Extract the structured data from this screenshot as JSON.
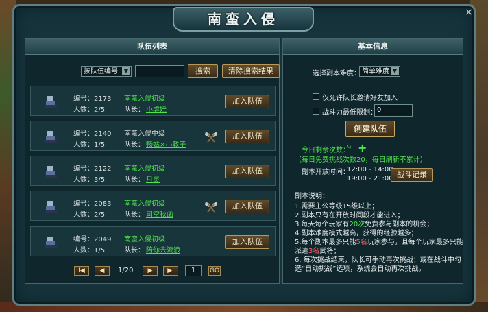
{
  "window": {
    "title": "南蛮入侵",
    "close": "×"
  },
  "team_list": {
    "header": "队伍列表",
    "filter_select": "按队伍编号",
    "search_value": "",
    "search_button": "搜索",
    "clear_button": "清除搜索结果",
    "teams": [
      {
        "id_label": "编号：2173",
        "count_label": "人数：2/5",
        "name": "南蛮入侵初级",
        "name_color": "green",
        "leader_prefix": "队长：",
        "leader": "小虐娃",
        "axe": false,
        "join": "加入队伍"
      },
      {
        "id_label": "编号：2140",
        "count_label": "人数：1/5",
        "name": "南蛮入侵中级",
        "name_color": "gray",
        "leader_prefix": "队长：",
        "leader": "畅姑×小敦子",
        "axe": true,
        "join": "加入队伍"
      },
      {
        "id_label": "编号：2122",
        "count_label": "人数：3/5",
        "name": "南蛮入侵初级",
        "name_color": "green",
        "leader_prefix": "队长：",
        "leader": "月灵",
        "axe": false,
        "join": "加入队伍"
      },
      {
        "id_label": "编号：2083",
        "count_label": "人数：2/5",
        "name": "南蛮入侵初级",
        "name_color": "green",
        "leader_prefix": "队长：",
        "leader": "司空秋函",
        "axe": true,
        "join": "加入队伍"
      },
      {
        "id_label": "编号：2049",
        "count_label": "人数：1/5",
        "name": "南蛮入侵初级",
        "name_color": "green",
        "leader_prefix": "队长：",
        "leader": "陪你去流浪",
        "axe": false,
        "join": "加入队伍"
      }
    ],
    "pager": {
      "first": "I◀",
      "prev": "◀",
      "page_text": "1/20",
      "next": "▶",
      "last": "▶I",
      "page_input": "1",
      "go": "GO"
    }
  },
  "basic_info": {
    "header": "基本信息",
    "difficulty_label": "选择副本难度：",
    "difficulty_value": "简单难度",
    "friends_only": "仅允许队长邀请好友加入",
    "power_limit_label": "战斗力最低限制：",
    "power_limit_value": "0",
    "create_button": "创建队伍",
    "remaining_label": "今日剩余次数：",
    "remaining_value": "9",
    "remaining_note": "（每日免费挑战次数20，每日刷新不累计）",
    "open_time_label": "副本开放时间：",
    "open_time_1": "12:00 - 14:00",
    "open_time_2": "19:00 - 21:00",
    "battle_log_button": "战斗记录",
    "desc_title": "副本说明：",
    "desc_1": "1.需要主公等级15级以上；",
    "desc_2": "2.副本只有在开放时间段才能进入；",
    "desc_3a": "3.每天每个玩家有",
    "desc_3b": "20次",
    "desc_3c": "免费参与副本的机会；",
    "desc_4": "4.副本难度模式越高，获得的经验越多；",
    "desc_5a": "5.每个副本最多只能",
    "desc_5b": "5名",
    "desc_5c": "玩家参与，且每个玩家最多只能派遣",
    "desc_5d": "3名",
    "desc_5e": "武将；",
    "desc_6": "6. 每次挑战结束，队长可手动再次挑战；或在战斗中勾选“自动挑战”选项，系统会自动再次挑战。"
  }
}
